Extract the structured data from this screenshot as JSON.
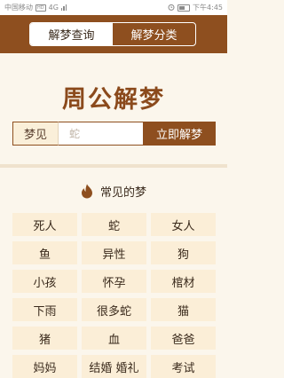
{
  "status_bar": {
    "carrier": "中国移动",
    "network_badge": "HD",
    "network_type": "4G",
    "time": "下午4:45"
  },
  "header": {
    "tabs": [
      {
        "label": "解梦查询",
        "active": true
      },
      {
        "label": "解梦分类",
        "active": false
      }
    ]
  },
  "title": "周公解梦",
  "search": {
    "label": "梦见",
    "placeholder": "蛇",
    "button_label": "立即解梦"
  },
  "common": {
    "icon": "flame-icon",
    "title": "常见的梦",
    "items": [
      "死人",
      "蛇",
      "女人",
      "鱼",
      "异性",
      "狗",
      "小孩",
      "怀孕",
      "棺材",
      "下雨",
      "很多蛇",
      "猫",
      "猪",
      "血",
      "爸爸",
      "妈妈",
      "结婚 婚礼",
      "考试"
    ]
  },
  "colors": {
    "brand_brown": "#8e4f1f",
    "title_brown": "#8b4a1c",
    "cell_bg": "#fbeed7",
    "page_bg": "#fbf6ec"
  }
}
